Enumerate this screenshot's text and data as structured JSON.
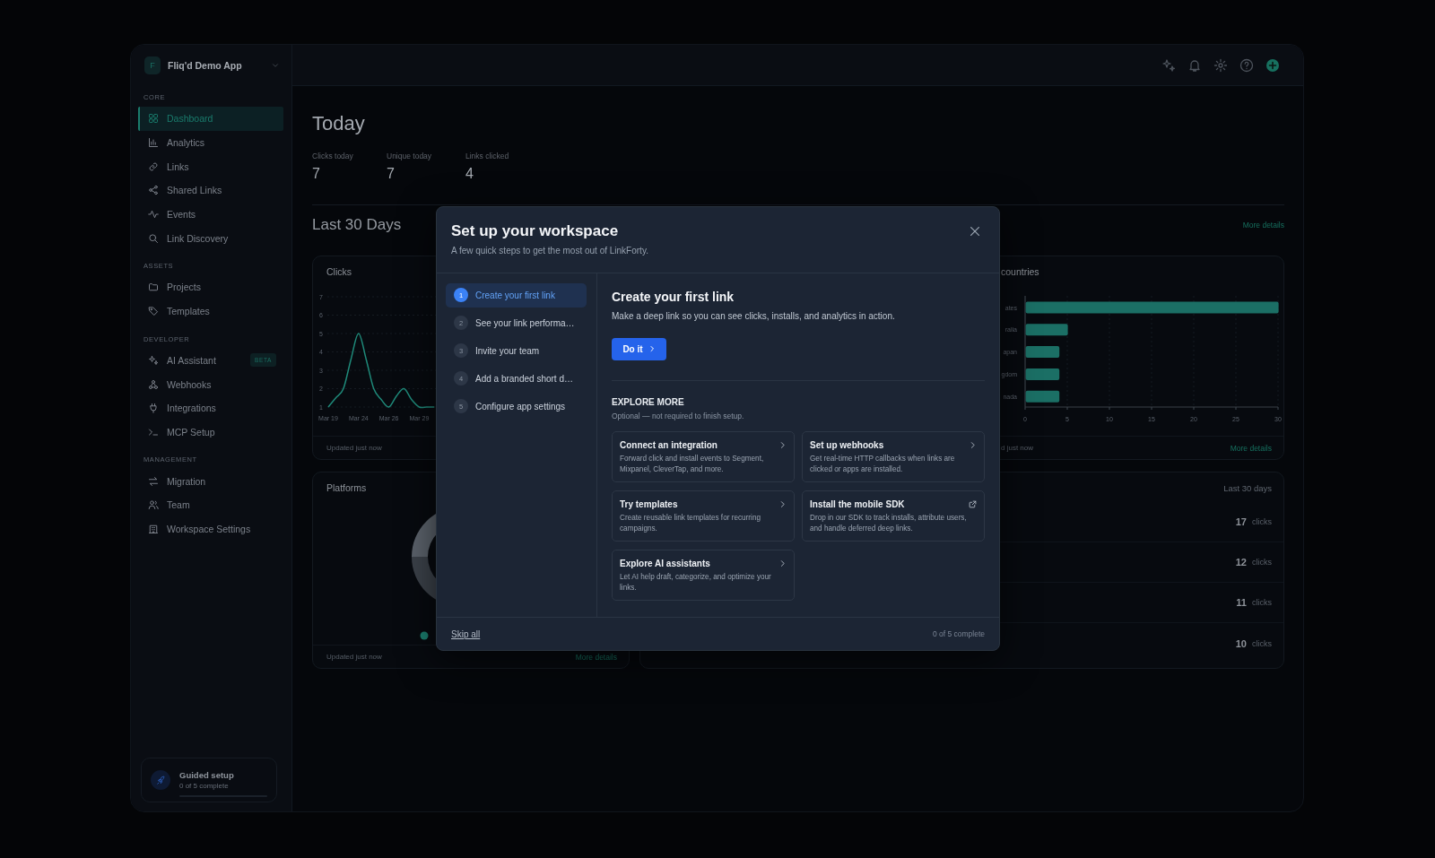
{
  "sidebar": {
    "app": {
      "initial": "F",
      "name": "Fliq'd Demo App"
    },
    "sections": [
      {
        "label": "CORE",
        "items": [
          {
            "label": "Dashboard",
            "selected": true
          },
          {
            "label": "Analytics",
            "selected": false
          },
          {
            "label": "Links",
            "selected": false
          },
          {
            "label": "Shared Links",
            "selected": false
          },
          {
            "label": "Events",
            "selected": false
          },
          {
            "label": "Link Discovery",
            "selected": false
          }
        ]
      },
      {
        "label": "ASSETS",
        "items": [
          {
            "label": "Projects",
            "selected": false
          },
          {
            "label": "Templates",
            "selected": false
          }
        ]
      },
      {
        "label": "DEVELOPER",
        "items": [
          {
            "label": "AI Assistant",
            "selected": false,
            "badge": "BETA"
          },
          {
            "label": "Webhooks",
            "selected": false
          },
          {
            "label": "Integrations",
            "selected": false
          },
          {
            "label": "MCP Setup",
            "selected": false
          }
        ]
      },
      {
        "label": "MANAGEMENT",
        "items": [
          {
            "label": "Migration",
            "selected": false
          },
          {
            "label": "Team",
            "selected": false
          },
          {
            "label": "Workspace Settings",
            "selected": false
          }
        ]
      }
    ],
    "guided_setup": {
      "title": "Guided setup",
      "progress": "0 of 5 complete",
      "level": 0
    }
  },
  "today": {
    "title": "Today",
    "stats": [
      {
        "label": "Clicks today",
        "value": "7"
      },
      {
        "label": "Unique today",
        "value": "7"
      },
      {
        "label": "Links clicked",
        "value": "4"
      }
    ]
  },
  "last_30_days": {
    "title": "Last 30 Days",
    "link": "More details"
  },
  "clicks_card": {
    "title": "Clicks",
    "footer": "Updated just now",
    "chart_data": {
      "type": "line",
      "grid": true,
      "categories": [
        "Mar 19",
        null,
        null,
        null,
        "Mar 24",
        null,
        null,
        null,
        "Mar 26",
        null,
        null,
        null,
        "Mar 29",
        null,
        null
      ],
      "yticks": [
        1,
        2,
        3,
        4,
        5,
        6,
        7
      ],
      "ylim": [
        1,
        7
      ],
      "series": [
        {
          "color": "#1f8a7a",
          "values": [
            1,
            1.5,
            2,
            3.6,
            5,
            3.6,
            2,
            1.4,
            1,
            1.6,
            2,
            1.4,
            1,
            1,
            1
          ]
        }
      ]
    }
  },
  "countries_card": {
    "title": "countries",
    "footer": "d just now",
    "link": "More details",
    "chart_data": {
      "type": "bar",
      "orientation": "horizontal",
      "grid": true,
      "categories": [
        "ates",
        "ralia",
        "apan",
        "gdom",
        "nada"
      ],
      "xlim": [
        0,
        30
      ],
      "xticks": [
        0,
        5,
        10,
        15,
        20,
        25,
        30
      ],
      "series": [
        {
          "color": "#1b6f65",
          "values": [
            30,
            5,
            4,
            4,
            4
          ]
        }
      ]
    }
  },
  "platforms_card": {
    "title": "Platforms",
    "footer": "Updated just now",
    "link": "More details"
  },
  "top_links_card": {
    "period": "Last 30 days",
    "rows": [
      {
        "count": "17",
        "unit": "clicks"
      },
      {
        "count": "12",
        "unit": "clicks"
      },
      {
        "count": "11",
        "unit": "clicks"
      },
      {
        "count": "10",
        "unit": "clicks"
      }
    ]
  },
  "modal": {
    "title": "Set up your workspace",
    "subtitle": "A few quick steps to get the most out of LinkForty.",
    "steps": [
      {
        "number": "1",
        "label": "Create your first link",
        "selected": true
      },
      {
        "number": "2",
        "label": "See your link performa…",
        "selected": false
      },
      {
        "number": "3",
        "label": "Invite your team",
        "selected": false
      },
      {
        "number": "4",
        "label": "Add a branded short d…",
        "selected": false
      },
      {
        "number": "5",
        "label": "Configure app settings",
        "selected": false
      }
    ],
    "detail": {
      "title": "Create your first link",
      "text": "Make a deep link so you can see clicks, installs, and analytics in action.",
      "button": "Do it"
    },
    "explore": {
      "title": "EXPLORE MORE",
      "subtitle": "Optional — not required to finish setup.",
      "cards": [
        {
          "title": "Connect an integration",
          "text": "Forward click and install events to Segment, Mixpanel, CleverTap, and more.",
          "kind": "arrow"
        },
        {
          "title": "Set up webhooks",
          "text": "Get real-time HTTP callbacks when links are clicked or apps are installed.",
          "kind": "arrow"
        },
        {
          "title": "Try templates",
          "text": "Create reusable link templates for recurring campaigns.",
          "kind": "arrow"
        },
        {
          "title": "Install the mobile SDK",
          "text": "Drop in our SDK to track installs, attribute users, and handle deferred deep links.",
          "kind": "external"
        },
        {
          "title": "Explore AI assistants",
          "text": "Let AI help draft, categorize, and optimize your links.",
          "kind": "arrow"
        }
      ]
    },
    "footer": {
      "skip": "Skip all",
      "progress": "0 of 5 complete"
    }
  }
}
